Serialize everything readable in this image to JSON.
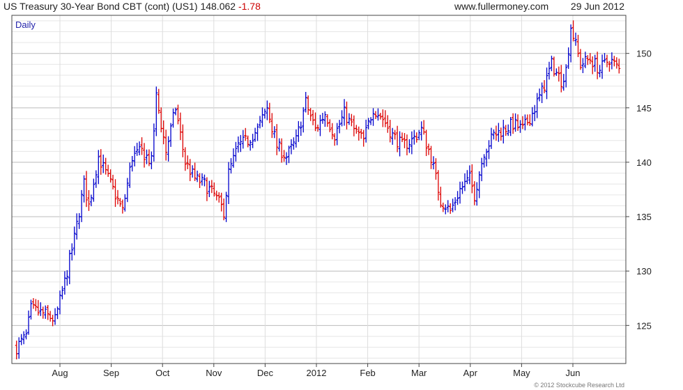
{
  "header": {
    "instrument": "US Treasury 30-Year  Bond CBT (cont) (US1)",
    "last": "148.062",
    "change": "-1.78",
    "website": "www.fullermoney.com",
    "date": "29 Jun 2012"
  },
  "footer": {
    "copyright": "© 2012 Stockcube Research Ltd"
  },
  "colors": {
    "up": "#0000cc",
    "down": "#dd0000",
    "grid": "#cccccc",
    "frame": "#444444"
  },
  "chart_data": {
    "type": "ohlc",
    "period_label": "Daily",
    "x_tick_labels": [
      "Aug",
      "Sep",
      "Oct",
      "Nov",
      "Dec",
      "2012",
      "Feb",
      "Mar",
      "Apr",
      "May",
      "Jun"
    ],
    "y_tick_labels": [
      125,
      130,
      135,
      140,
      145,
      150
    ],
    "ylim": [
      121.5,
      153.5
    ],
    "grid": true,
    "y_axis_side": "right",
    "anchor_closes": [
      [
        0,
        123
      ],
      [
        4,
        124
      ],
      [
        6,
        126.5
      ],
      [
        12,
        126
      ],
      [
        16,
        125.5
      ],
      [
        20,
        129
      ],
      [
        24,
        133
      ],
      [
        28,
        138
      ],
      [
        30,
        136
      ],
      [
        34,
        140.5
      ],
      [
        40,
        137.5
      ],
      [
        44,
        135.5
      ],
      [
        48,
        140.5
      ],
      [
        52,
        141
      ],
      [
        56,
        140
      ],
      [
        58,
        146
      ],
      [
        62,
        141
      ],
      [
        66,
        145
      ],
      [
        70,
        140
      ],
      [
        74,
        138.5
      ],
      [
        78,
        138
      ],
      [
        82,
        137
      ],
      [
        86,
        135.5
      ],
      [
        88,
        139
      ],
      [
        92,
        141.5
      ],
      [
        96,
        142
      ],
      [
        100,
        143
      ],
      [
        104,
        145
      ],
      [
        108,
        141.5
      ],
      [
        112,
        140.5
      ],
      [
        116,
        142
      ],
      [
        120,
        145.5
      ],
      [
        124,
        143
      ],
      [
        128,
        144.5
      ],
      [
        132,
        142.5
      ],
      [
        136,
        144.5
      ],
      [
        140,
        143
      ],
      [
        144,
        142
      ],
      [
        148,
        145
      ],
      [
        152,
        144
      ],
      [
        156,
        142.5
      ],
      [
        160,
        141.5
      ],
      [
        164,
        142
      ],
      [
        168,
        143
      ],
      [
        172,
        140.5
      ],
      [
        176,
        136.5
      ],
      [
        180,
        135.5
      ],
      [
        184,
        137.5
      ],
      [
        188,
        138.5
      ],
      [
        190,
        137
      ],
      [
        194,
        141
      ],
      [
        198,
        142.5
      ],
      [
        202,
        143
      ],
      [
        206,
        143.5
      ],
      [
        210,
        143
      ],
      [
        214,
        144.5
      ],
      [
        218,
        146.5
      ],
      [
        222,
        149
      ],
      [
        226,
        147.5
      ],
      [
        228,
        148.5
      ],
      [
        230,
        152.5
      ],
      [
        234,
        149
      ],
      [
        238,
        149.5
      ],
      [
        242,
        148.5
      ],
      [
        246,
        149.5
      ],
      [
        250,
        148.5
      ]
    ]
  }
}
